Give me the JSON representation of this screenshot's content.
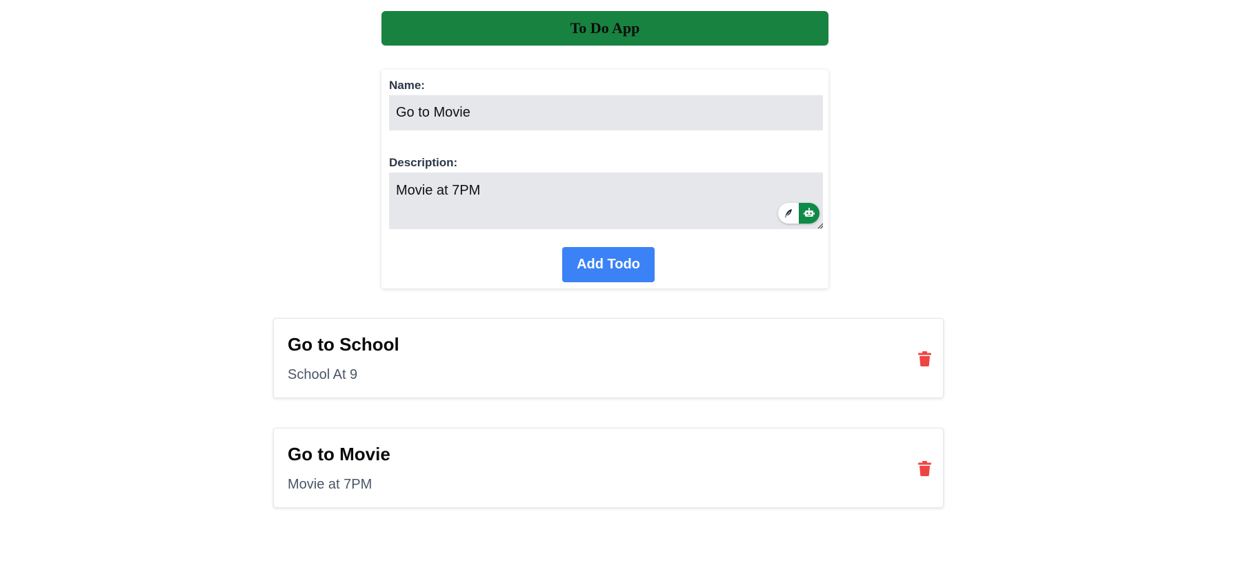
{
  "header": {
    "title": "To Do App",
    "background_color": "#188340"
  },
  "form": {
    "name_label": "Name:",
    "name_value": "Go to Movie",
    "description_label": "Description:",
    "description_value": "Movie at 7PM",
    "extension_icons": [
      "feather-icon",
      "robot-icon"
    ],
    "submit_label": "Add Todo",
    "submit_color": "#3b82f6"
  },
  "todos": [
    {
      "title": "Go to School",
      "description": "School At 9"
    },
    {
      "title": "Go to Movie",
      "description": "Movie at 7PM"
    }
  ],
  "colors": {
    "delete_icon": "#ef4444",
    "extension_accent": "#0f8a47"
  }
}
